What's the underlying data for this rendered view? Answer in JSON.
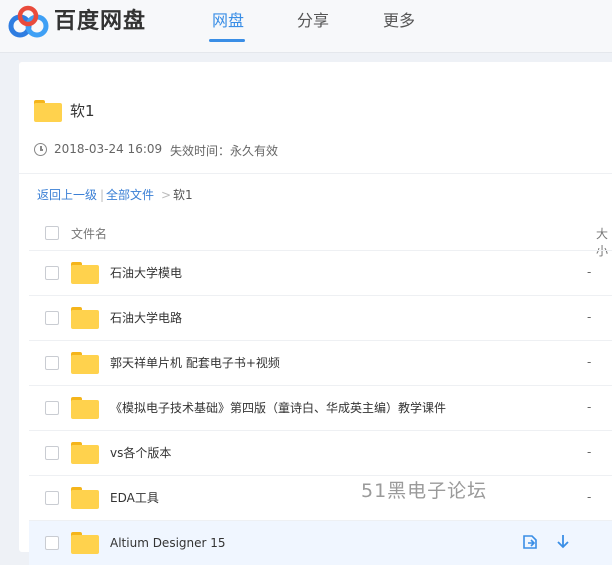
{
  "header": {
    "brand": "百度网盘",
    "nav": [
      "网盘",
      "分享",
      "更多"
    ],
    "active_nav": "网盘",
    "accent_color": "#3a8ee6"
  },
  "share": {
    "title": "软1",
    "timestamp": "2018-03-24 16:09",
    "expiry": "失效时间：永久有效"
  },
  "breadcrumb": {
    "back": "返回上一级",
    "separator": "|",
    "all_files": "全部文件",
    "arrow": ">",
    "current": "软1"
  },
  "table": {
    "col_name": "文件名",
    "col_size": "大小",
    "rows": [
      {
        "name": "石油大学模电",
        "size": "-"
      },
      {
        "name": "石油大学电路",
        "size": "-"
      },
      {
        "name": "郭天祥单片机 配套电子书+视频",
        "size": "-"
      },
      {
        "name": "《模拟电子技术基础》第四版（童诗白、华成英主编）教学课件",
        "size": "-"
      },
      {
        "name": "vs各个版本",
        "size": "-"
      },
      {
        "name": "EDA工具",
        "size": "-"
      },
      {
        "name": "Altium Designer 15",
        "size": ""
      }
    ]
  },
  "watermark": "51黑电子论坛",
  "icons": {
    "logo": "baidu-netdisk-logo",
    "clock": "clock-icon",
    "folder": "folder-icon",
    "save": "save-icon",
    "download": "download-icon"
  }
}
